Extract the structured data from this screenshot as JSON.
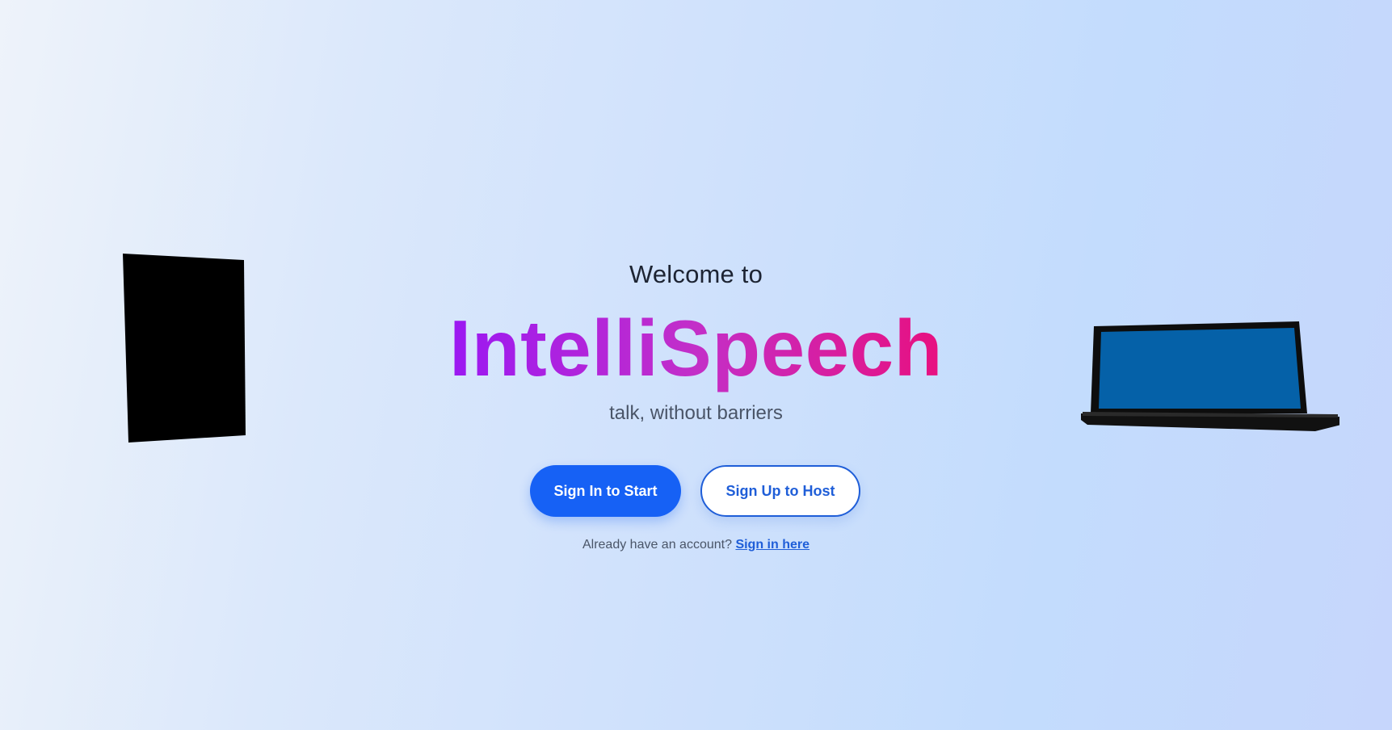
{
  "hero": {
    "welcome": "Welcome to",
    "brand": "IntelliSpeech",
    "tagline": "talk, without barriers"
  },
  "actions": {
    "sign_in_label": "Sign In to Start",
    "sign_up_label": "Sign Up to Host"
  },
  "account": {
    "prompt": "Already have an account?",
    "link": "Sign in here"
  },
  "decor": {
    "left_device": "tablet-icon",
    "right_device": "laptop-icon"
  },
  "colors": {
    "primary": "#1661f5",
    "brand_start": "#9b18f2",
    "brand_end": "#e8107f",
    "laptop_screen": "#0561a8"
  }
}
